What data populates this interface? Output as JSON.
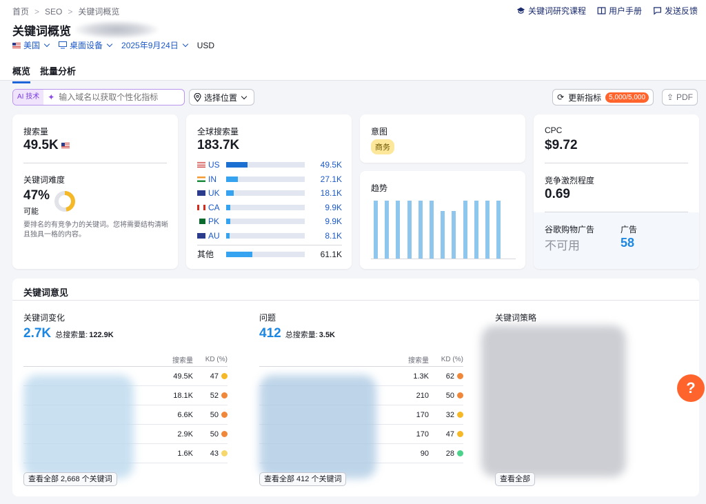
{
  "breadcrumb": {
    "home": "首页",
    "seo": "SEO",
    "current": "关键词概览"
  },
  "header_links": {
    "course": "关键词研究课程",
    "manual": "用户手册",
    "feedback": "发送反馈"
  },
  "page_title": "关键词概览",
  "filters": {
    "country": "美国",
    "device": "桌面设备",
    "date": "2025年9月24日",
    "currency": "USD"
  },
  "tabs": [
    "概览",
    "批量分析"
  ],
  "toolbar": {
    "ai_badge": "AI 技术",
    "ai_placeholder": "输入域名以获取个性化指标",
    "location": "选择位置",
    "update": "更新指标",
    "update_count": "5,000/5,000",
    "pdf": "PDF"
  },
  "volume_card": {
    "label": "搜索量",
    "value": "49.5K",
    "kd_label": "关键词难度",
    "kd_value": "47%",
    "kd_level": "可能",
    "kd_percent": 47,
    "kd_desc": "要排名的有竞争力的关键词。您将需要结构清晰且独具一格的内容。"
  },
  "global_card": {
    "label": "全球搜索量",
    "value": "183.7K",
    "rows": [
      {
        "code": "US",
        "value": "49.5K",
        "share": 0.27
      },
      {
        "code": "IN",
        "value": "27.1K",
        "share": 0.15
      },
      {
        "code": "UK",
        "value": "18.1K",
        "share": 0.1
      },
      {
        "code": "CA",
        "value": "9.9K",
        "share": 0.05
      },
      {
        "code": "PK",
        "value": "9.9K",
        "share": 0.05
      },
      {
        "code": "AU",
        "value": "8.1K",
        "share": 0.04
      }
    ],
    "other_label": "其他",
    "other_value": "61.1K",
    "other_share": 0.33
  },
  "intent_card": {
    "label": "意图",
    "tag": "商务"
  },
  "trend_card": {
    "label": "趋势",
    "values": [
      1,
      1,
      1,
      1,
      1,
      1,
      0.82,
      0.82,
      1,
      1,
      1,
      1
    ]
  },
  "cpc_card": {
    "cpc_label": "CPC",
    "cpc_value": "$9.72",
    "comp_label": "竞争激烈程度",
    "comp_value": "0.69",
    "shopping_label": "谷歌购物广告",
    "shopping_value": "不可用",
    "ads_label": "广告",
    "ads_value": "58"
  },
  "ideas": {
    "title": "关键词意见",
    "variations": {
      "title": "关键词变化",
      "count": "2.7K",
      "total_label": "总搜索量:",
      "total": "122.9K",
      "col_volume": "搜索量",
      "col_kd": "KD (%)",
      "rows": [
        {
          "vol": "49.5K",
          "kd": "47",
          "color": "#f5b928"
        },
        {
          "vol": "18.1K",
          "kd": "52",
          "color": "#f0883c"
        },
        {
          "vol": "6.6K",
          "kd": "50",
          "color": "#f0883c"
        },
        {
          "vol": "2.9K",
          "kd": "50",
          "color": "#f0883c"
        },
        {
          "vol": "1.6K",
          "kd": "43",
          "color": "#f5d76b"
        }
      ],
      "view_all": "查看全部 2,668 个关键词"
    },
    "questions": {
      "title": "问题",
      "count": "412",
      "total_label": "总搜索量:",
      "total": "3.5K",
      "col_volume": "搜索量",
      "col_kd": "KD (%)",
      "rows": [
        {
          "vol": "1.3K",
          "kd": "62",
          "color": "#f0883c"
        },
        {
          "vol": "210",
          "kd": "50",
          "color": "#f0883c"
        },
        {
          "vol": "170",
          "kd": "32",
          "color": "#f5b928"
        },
        {
          "vol": "170",
          "kd": "47",
          "color": "#f5b928"
        },
        {
          "vol": "90",
          "kd": "28",
          "color": "#4cd28a"
        }
      ],
      "view_all": "查看全部 412 个关键词"
    },
    "strategy": {
      "title": "关键词策略",
      "view_all": "查看全部"
    }
  },
  "help_label": "?"
}
